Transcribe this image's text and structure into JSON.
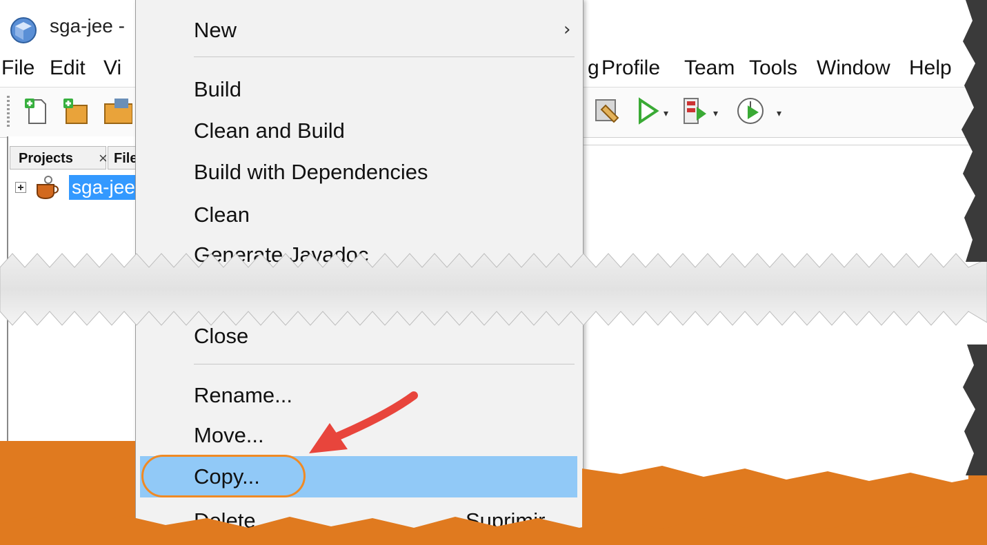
{
  "window": {
    "title": "sga-jee -"
  },
  "menubar": {
    "items": [
      "File",
      "Edit",
      "Vi",
      "g",
      "Profile",
      "Team",
      "Tools",
      "Window",
      "Help"
    ]
  },
  "projects_panel": {
    "tab_projects": "Projects",
    "tab_close": "×",
    "tab_files": "File",
    "tree_root_label": "sga-jee"
  },
  "context_menu": {
    "items": [
      {
        "label": "New",
        "submenu": true
      },
      {
        "label": "Build"
      },
      {
        "label": "Clean and Build"
      },
      {
        "label": "Build with Dependencies"
      },
      {
        "label": "Clean"
      },
      {
        "label": "Generate Javadoc"
      },
      {
        "label": "Close"
      },
      {
        "label": "Rename..."
      },
      {
        "label": "Move..."
      },
      {
        "label": "Copy...",
        "highlighted": true
      },
      {
        "label": "Delete",
        "shortcut": "Suprimir"
      }
    ],
    "submenu_arrow": "›"
  },
  "colors": {
    "highlight": "#91c9f7",
    "selection": "#3399ff",
    "ring": "#f08a24",
    "arrow": "#e8453c",
    "torn_background": "#e07a1f"
  },
  "icons": [
    "new-file-icon",
    "new-project-icon",
    "open-project-icon",
    "clean-build-icon",
    "run-icon",
    "debug-icon",
    "profile-icon",
    "app-cube-icon",
    "project-cup-icon"
  ]
}
